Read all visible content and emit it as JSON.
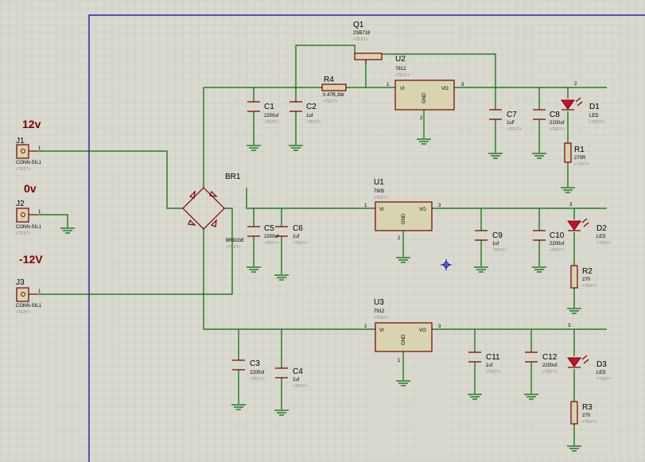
{
  "rails": [
    "12v",
    "0v",
    "-12V"
  ],
  "text_placeholder": "<TEXT>",
  "connectors": [
    {
      "ref": "J1",
      "value": "CONN-SIL1",
      "pin": "1"
    },
    {
      "ref": "J2",
      "value": "CONN-SIL1",
      "pin": "1"
    },
    {
      "ref": "J3",
      "value": "CONN-SIL1",
      "pin": "1"
    }
  ],
  "bridge": {
    "ref": "BR1",
    "value": "BRIDGE"
  },
  "transistor": {
    "ref": "Q1",
    "value": "2SB718"
  },
  "resistors": [
    {
      "ref": "R4",
      "value": "0.47R,3W"
    },
    {
      "ref": "R1",
      "value": "270R"
    },
    {
      "ref": "R2",
      "value": "270"
    },
    {
      "ref": "R3",
      "value": "270"
    }
  ],
  "regulators": [
    {
      "ref": "U2",
      "value": "7812",
      "vi": "VI",
      "vo": "VO",
      "gnd": "GND",
      "pin_in": "1",
      "pin_out": "3",
      "pin_gnd": "2"
    },
    {
      "ref": "U1",
      "value": "7805",
      "vi": "VI",
      "vo": "VO",
      "gnd": "GND",
      "pin_in": "1",
      "pin_out": "3",
      "pin_gnd": "2"
    },
    {
      "ref": "U3",
      "value": "7912",
      "vi": "VI",
      "vo": "VO",
      "gnd": "GND",
      "pin_in": "2",
      "pin_out": "3",
      "pin_gnd": "1"
    }
  ],
  "capacitors": [
    {
      "ref": "C1",
      "value": "2200uf"
    },
    {
      "ref": "C2",
      "value": "1uf"
    },
    {
      "ref": "C7",
      "value": "1uF"
    },
    {
      "ref": "C8",
      "value": "2200uf"
    },
    {
      "ref": "C5",
      "value": "2200uf"
    },
    {
      "ref": "C6",
      "value": "1uf"
    },
    {
      "ref": "C9",
      "value": "1uf"
    },
    {
      "ref": "C10",
      "value": "2200uf"
    },
    {
      "ref": "C3",
      "value": "2200uf"
    },
    {
      "ref": "C4",
      "value": "1uf"
    },
    {
      "ref": "C11",
      "value": "1uf"
    },
    {
      "ref": "C12",
      "value": "2200uf"
    }
  ],
  "leds": [
    {
      "ref": "D1",
      "value": "LED"
    },
    {
      "ref": "D2",
      "value": "LED"
    },
    {
      "ref": "D3",
      "value": "LED"
    }
  ],
  "net_labels": {
    "d1_top": "2",
    "d2_top": "3",
    "d3_top": "3"
  },
  "colors": {
    "background": "#d9d9cf",
    "grid": "#c5c5ba",
    "wire": "#006b00",
    "part": "#7a0000",
    "sheet_border": "#0000a8",
    "text": "#8a8a80"
  }
}
